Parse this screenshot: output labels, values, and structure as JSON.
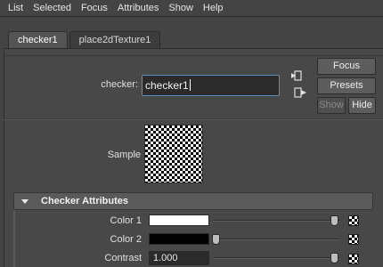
{
  "menu": [
    "List",
    "Selected",
    "Focus",
    "Attributes",
    "Show",
    "Help"
  ],
  "tabs": [
    {
      "label": "checker1",
      "active": true
    },
    {
      "label": "place2dTexture1",
      "active": false
    }
  ],
  "node": {
    "label": "checker:",
    "value": "checker1"
  },
  "buttons": {
    "focus": "Focus",
    "presets": "Presets",
    "show": "Show",
    "hide": "Hide"
  },
  "sample": {
    "label": "Sample"
  },
  "section": {
    "title": "Checker Attributes",
    "expanded": true
  },
  "attributes": [
    {
      "label": "Color 1",
      "type": "color",
      "color": "#ffffff",
      "slider_fraction": 1.0
    },
    {
      "label": "Color 2",
      "type": "color",
      "color": "#000000",
      "slider_fraction": 0.0
    },
    {
      "label": "Contrast",
      "type": "number",
      "value": "1.000",
      "slider_fraction": 1.0
    }
  ],
  "icons": {
    "input_connection": "input-connection-icon",
    "output_connection": "output-connection-icon",
    "map_button": "checker-map-icon",
    "section_toggle": "triangle-down-icon"
  }
}
